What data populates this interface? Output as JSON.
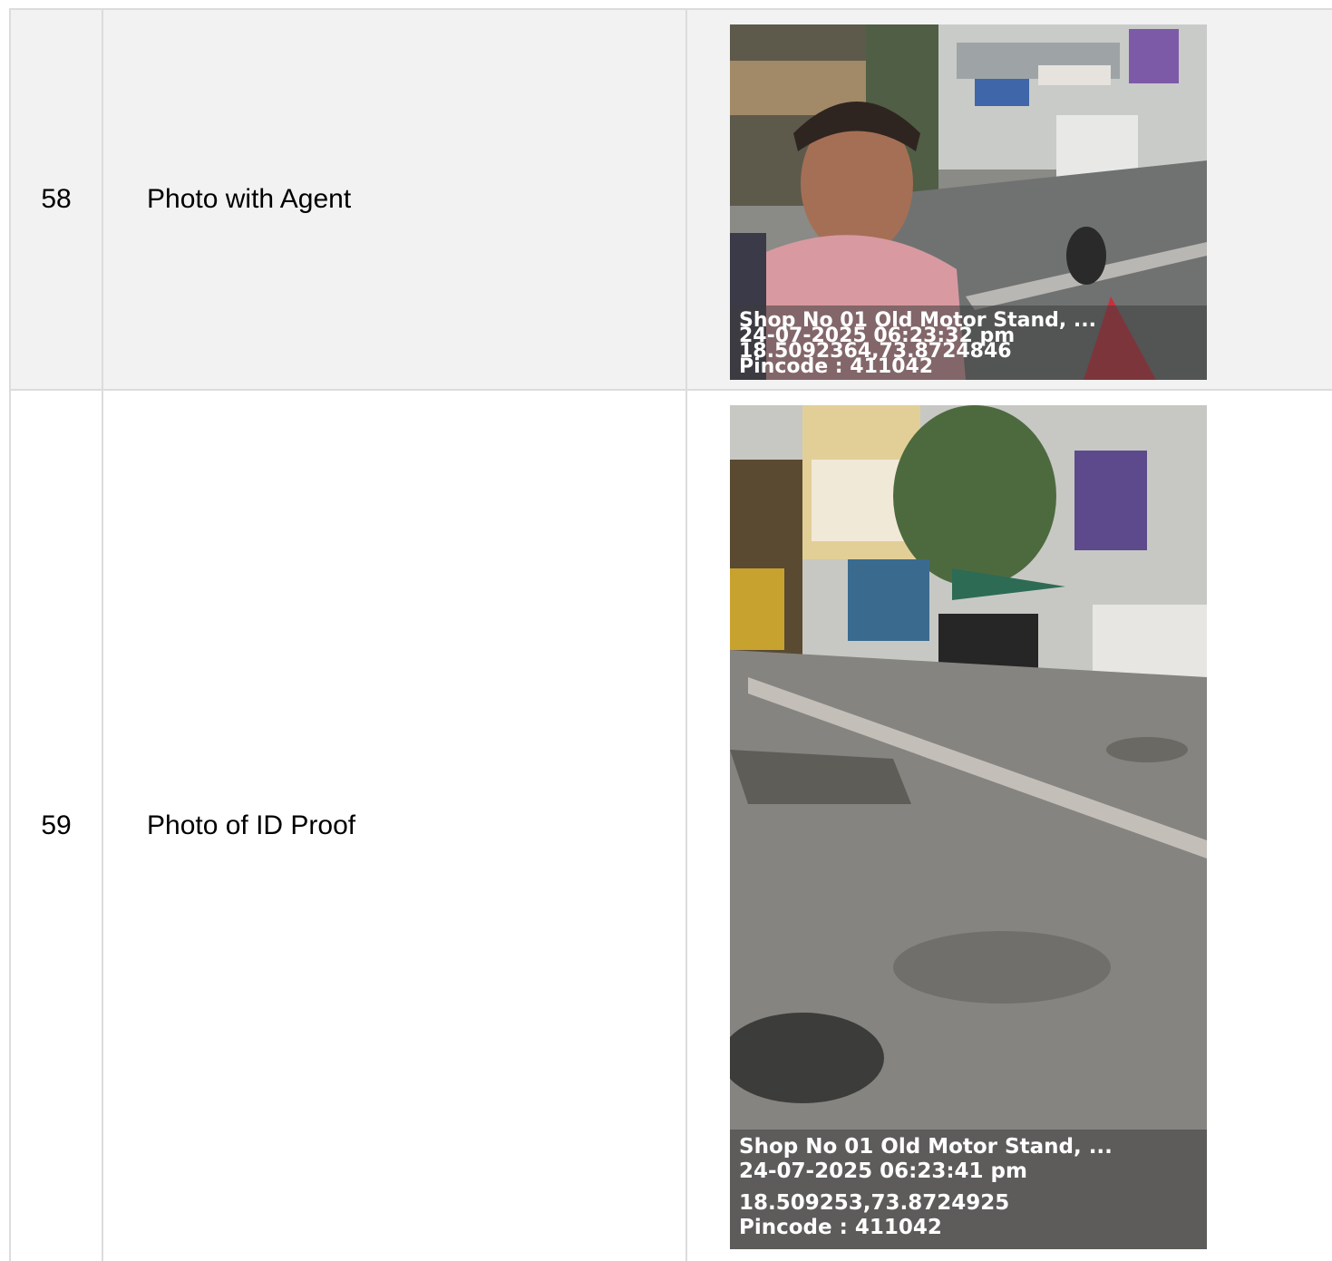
{
  "rows": [
    {
      "number": "58",
      "label": "Photo with Agent",
      "photo": {
        "description": "selfie-photo",
        "overlay": [
          "Shop No 01 Old Motor Stand, ...",
          "24-07-2025 06:23:32 pm",
          "18.5092364,73.8724846",
          "Pincode : 411042"
        ]
      }
    },
    {
      "number": "59",
      "label": "Photo of ID Proof",
      "photo": {
        "description": "street-photo",
        "overlay": [
          "Shop No 01 Old Motor Stand, ...",
          "24-07-2025 06:23:41 pm",
          "18.509253,73.8724925",
          "Pincode : 411042"
        ]
      }
    }
  ]
}
